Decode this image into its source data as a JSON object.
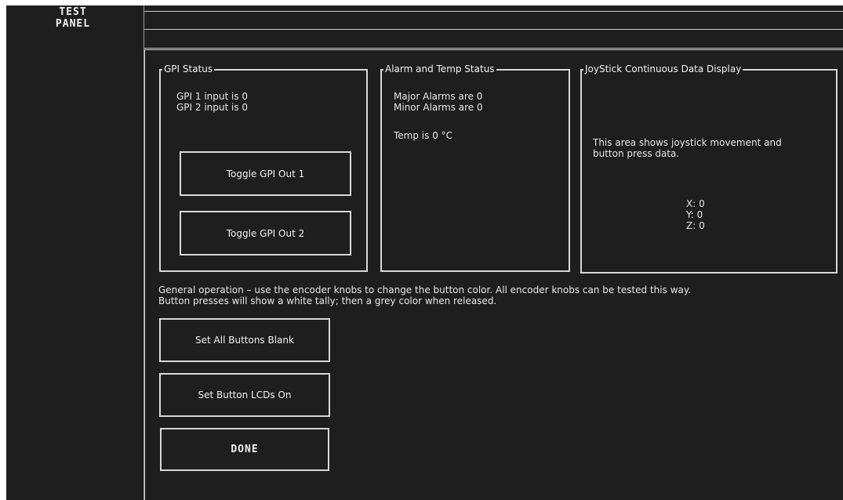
{
  "sidebar": {
    "title_line1": "TEST",
    "title_line2": "PANEL"
  },
  "gpi_status": {
    "legend": "GPI Status",
    "line1": "GPI 1 input is 0",
    "line2": "GPI 2 input is 0",
    "toggle1_label": "Toggle GPI Out 1",
    "toggle2_label": "Toggle GPI Out 2"
  },
  "alarm_temp": {
    "legend": "Alarm and Temp Status",
    "major": "Major Alarms are 0",
    "minor": "Minor Alarms are 0",
    "temp": "Temp is 0 °C"
  },
  "joystick": {
    "legend": "JoyStick Continuous Data Display",
    "desc_line1": "This area shows joystick movement and",
    "desc_line2": "button press data.",
    "x": "X: 0",
    "y": "Y: 0",
    "z": "Z: 0"
  },
  "instructions": {
    "line1": "General operation – use the encoder knobs to change the button color.  All encoder knobs can be tested this way.",
    "line2": "Button presses will show a white tally; then a grey color when released."
  },
  "buttons": {
    "set_blank": "Set All Buttons Blank",
    "set_lcds_on": "Set Button  LCDs On",
    "done": "DONE"
  }
}
